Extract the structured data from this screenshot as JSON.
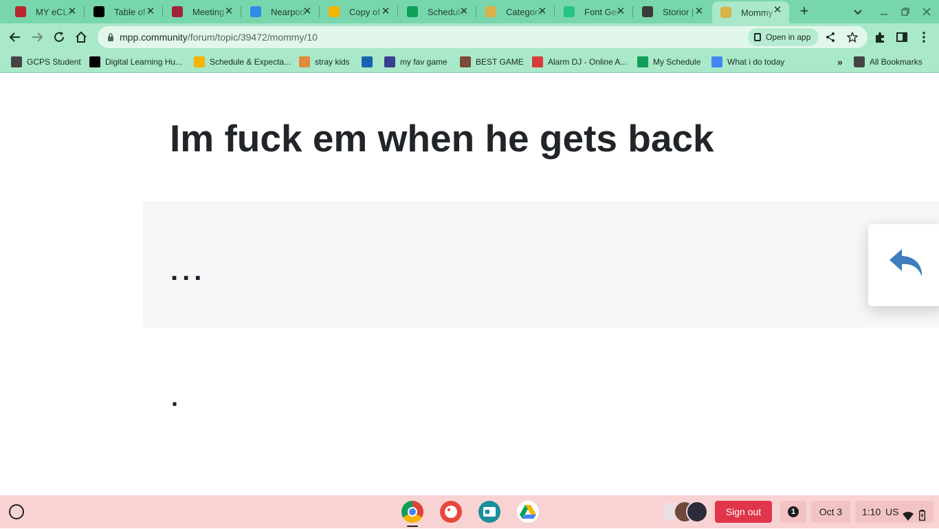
{
  "browser": {
    "tabs": [
      {
        "title": "MY eCLASS",
        "favicon": "eclass-icon",
        "color": "#b9262d"
      },
      {
        "title": "Table of Contents",
        "favicon": "d2l-icon",
        "color": "#000000"
      },
      {
        "title": "Meeting",
        "favicon": "meeting-icon",
        "color": "#a2243a"
      },
      {
        "title": "Nearpod",
        "favicon": "nearpod-icon",
        "color": "#2f8be8"
      },
      {
        "title": "Copy of",
        "favicon": "slides-icon",
        "color": "#f4b400"
      },
      {
        "title": "Schedule",
        "favicon": "sheets-icon",
        "color": "#0f9d58"
      },
      {
        "title": "Categories",
        "favicon": "music-icon",
        "color": "#d8b24a"
      },
      {
        "title": "Font Generator",
        "favicon": "font-icon",
        "color": "#25c484"
      },
      {
        "title": "Storior |",
        "favicon": "pin-icon",
        "color": "#3a3a3a"
      },
      {
        "title": "Mommy",
        "favicon": "music-icon",
        "color": "#d8b24a"
      }
    ],
    "new_tab_label": "+",
    "url_host": "mpp.community",
    "url_path": "/forum/topic/39472/mommy/10",
    "open_in_app_label": "Open in app"
  },
  "bookmarks": {
    "items": [
      {
        "label": "GCPS Student",
        "icon": "building-icon",
        "color": "#444444"
      },
      {
        "label": "Digital Learning Hu...",
        "icon": "d2l-icon",
        "color": "#000000"
      },
      {
        "label": "Schedule & Expecta...",
        "icon": "slides-icon",
        "color": "#f4b400"
      },
      {
        "label": "stray kids",
        "icon": "pinterest-icon",
        "color": "#e08a3a"
      },
      {
        "label": "",
        "icon": "e-icon",
        "color": "#1763b0"
      },
      {
        "label": "my fav game",
        "icon": "game-icon",
        "color": "#3a3f8f"
      },
      {
        "label": "BEST GAME",
        "icon": "face-icon",
        "color": "#7a4a36"
      },
      {
        "label": "Alarm DJ - Online A...",
        "icon": "alarm-icon",
        "color": "#d83b3b"
      },
      {
        "label": "My Schedule",
        "icon": "sheets-icon",
        "color": "#0f9d58"
      },
      {
        "label": "What i do today",
        "icon": "docs-icon",
        "color": "#4285f4"
      }
    ],
    "all_bookmarks_label": "All Bookmarks"
  },
  "page": {
    "title": "Im fuck em when he gets back",
    "quote_text": "...",
    "body_text": "."
  },
  "shelf": {
    "sign_out_label": "Sign out",
    "notification_count": "1",
    "date": "Oct 3",
    "time": "1:10",
    "input_method": "US"
  }
}
